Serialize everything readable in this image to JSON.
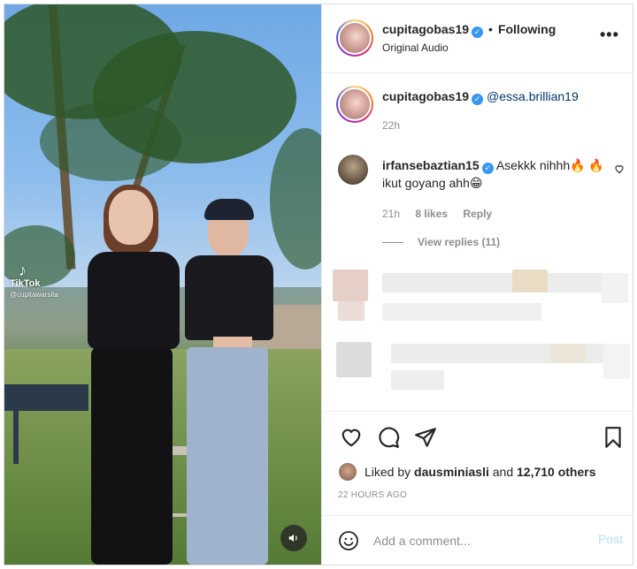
{
  "post": {
    "username": "cupitagobas19",
    "following": "Following",
    "separator": "•",
    "audio": "Original Audio"
  },
  "caption": {
    "username": "cupitagobas19",
    "mention": "@essa.brillian19",
    "time": "22h"
  },
  "comment": {
    "username": "irfansebaztian15",
    "text": "Asekkk nihhh🔥 🔥 ikut goyang ahh😁",
    "time": "21h",
    "likes": "8 likes",
    "reply": "Reply",
    "view_replies": "View replies (11)"
  },
  "media": {
    "watermark": "TikTok",
    "watermark_handle": "@cupitawarsita"
  },
  "likes": {
    "prefix": "Liked by",
    "user": "dausminiasli",
    "middle": "and",
    "others": "12,710 others"
  },
  "timestamp": "22 HOURS AGO",
  "comment_box": {
    "placeholder": "Add a comment...",
    "post_label": "Post"
  },
  "colors": {
    "link": "#00376b",
    "verified": "#3897f0",
    "muted": "#8e8e8e",
    "post_disabled": "#b2dffc"
  }
}
